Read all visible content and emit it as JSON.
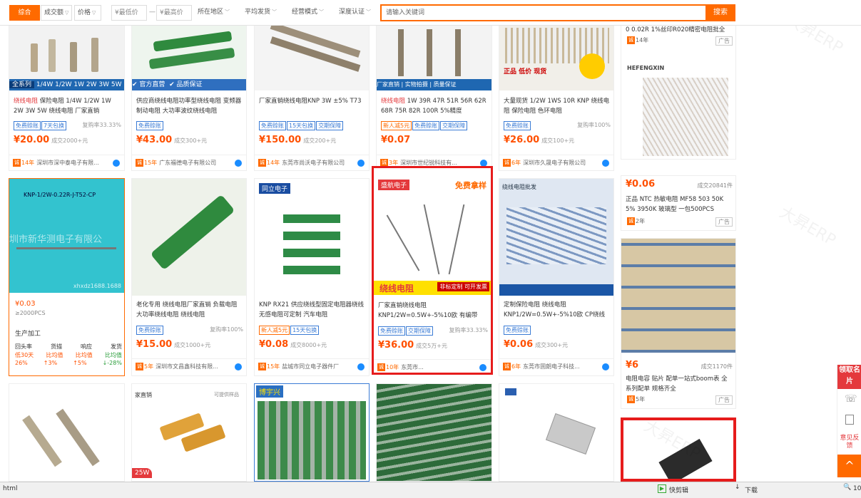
{
  "filters": {
    "comprehensive": "综合",
    "sales": "成交额",
    "price": "价格",
    "min_price": "¥最低价",
    "dash": "—",
    "max_price": "¥最高价",
    "location": "所在地区",
    "avg_ship": "平均发货",
    "business_mode": "经营模式",
    "deep_cert": "深度认证"
  },
  "search": {
    "placeholder": "请输入关键词",
    "button": "搜索"
  },
  "watermark": "大昇ERP",
  "row1": [
    {
      "banner_a": "全系列",
      "banner_b": "1/4W 1/2W 1W 2W 3W 5W",
      "title_red": "绕线电阻",
      "title_rest": " 保险电阻 1/4W 1/2W 1W 2W 3W 5W 绕线电阻 厂家直销",
      "tags": [
        "免费赊账",
        "7天包换"
      ],
      "repurchase": "复购率33.33%",
      "price": "¥20.00",
      "deals": "成交2000+元",
      "years": "14年",
      "shop": "深圳市深中泰电子有限..."
    },
    {
      "banner_a": "官方直营",
      "banner_b": "品质保证",
      "title_red": "",
      "title_rest": "供应商绕线电阻功率型绕线电阻 变频器制动电阻 大功率波纹绕线电阻",
      "tags": [
        "免费赊账"
      ],
      "repurchase": "",
      "price": "¥43.00",
      "deals": "成交300+元",
      "years": "15年",
      "shop": "广东福德电子有限公司"
    },
    {
      "title_red": "",
      "title_rest": "厂家直销绕线电阻KNP 3W ±5% T73",
      "tags": [
        "免费赊账",
        "15天包换",
        "交期保障"
      ],
      "repurchase": "",
      "price": "¥150.00",
      "deals": "成交200+元",
      "years": "14年",
      "shop": "东莞市尚沃电子有限公司"
    },
    {
      "banners": [
        "厂家直销",
        "实物拍摄",
        "质量保证"
      ],
      "title_red": "绕线电阻",
      "title_rest": " 1W 39R 47R 51R 56R 62R 68R 75R 82R 100R 5%精度",
      "tags": [
        "新人减5元",
        "免费赊账",
        "交期保障"
      ],
      "repurchase": "",
      "price": "¥0.07",
      "deals": "",
      "years": "3年",
      "shop": "深圳市世纪锐科技有..."
    },
    {
      "overlay": "正品 低价 现货",
      "title_red": "",
      "title_rest": "大量现货 1/2W 1WS 10R KNP 绕线电阻 保险电阻 色环电阻",
      "tags": [
        "免费赊账"
      ],
      "repurchase": "复购率100%",
      "price": "¥26.00",
      "deals": "成交100+元",
      "years": "6年",
      "shop": "深圳市久晟电子有限公司"
    }
  ],
  "row2": [
    {
      "img_label": "KNP-1/2W-0.22R-J-T52-CP",
      "img_company": "圳市新华测电子有限公",
      "img_site": "xhxdz1688.1688",
      "price": "¥0.03",
      "moq": "≥2000PCS",
      "section": "生产加工",
      "stats": [
        {
          "k": "回头率",
          "v": "26%",
          "c": "低30天"
        },
        {
          "k": "货描",
          "v": "↑3%",
          "c": "比均值"
        },
        {
          "k": "响应",
          "v": "↑5%",
          "c": "比均值"
        },
        {
          "k": "发货",
          "v": "↓-28%",
          "c": "比均值"
        }
      ]
    },
    {
      "title_red": "",
      "title_rest": "老化专用 绕线电阻厂家直销 负载电阻 大功率绕线电阻 绕线电阻",
      "tags": [
        "免费赊账"
      ],
      "repurchase": "复购率100%",
      "price": "¥15.00",
      "deals": "成交1000+元",
      "years": "5年",
      "shop": "深圳市文昌鑫科技有限..."
    },
    {
      "brand": "同立电子",
      "title_rest": "KNP RX21 供应绕线型固定电阻器绕线无感电阻可定制 汽车电阻",
      "tags": [
        "新人减5元",
        "15天包换"
      ],
      "repurchase": "",
      "price": "¥0.08",
      "deals": "成交8000+元",
      "years": "15年",
      "shop": "盐城市同立电子器件厂"
    },
    {
      "brand": "盛航电子",
      "badge": "免费拿样",
      "img_title": "绕线电阻",
      "img_tag": "非标定制 可开发票",
      "title_rest": "厂家直销绕线电阻 KNP1/2W=0.5W+-5%10欧 有编带",
      "tags": [
        "免费赊账",
        "交期保障"
      ],
      "repurchase": "复购率33.33%",
      "price": "¥36.00",
      "deals": "成交5万+元",
      "years": "10年",
      "shop": "东莞市..."
    },
    {
      "header": "绕线电阻批发",
      "title_rest": "定制保险电阻 绕线电阻 KNP1/2W=0.5W+-5%10欧 CP绕线",
      "tags": [
        "免费赊账"
      ],
      "repurchase": "",
      "price": "¥0.06",
      "deals": "成交300+元",
      "years": "6年",
      "shop": "东莞市固朗电子科技..."
    }
  ],
  "right": {
    "top_title": "0 0.02R 1%丝印R020精密电阻批全",
    "top_years": "14年",
    "ad": "广告",
    "brand": "HEFENGXIN",
    "p1_price": "¥0.06",
    "p1_deals": "成交20841件",
    "p1_title": "正品 NTC 热敏电阻 MF58 503 50K 5% 3950K 玻璃型 一包500PCS",
    "p1_years": "2年",
    "p2_price": "¥6",
    "p2_deals": "成交1170件",
    "p2_title": "电阻电容 贴片 配单一站式boom表 全系列配单 规格齐全",
    "p2_years": "5年"
  },
  "row3": [
    {
      "label": ""
    },
    {
      "header": "家直销",
      "sub": "可提供样品",
      "tag": "25W"
    },
    {
      "brand": "博宇兴"
    },
    {
      "label": ""
    },
    {
      "label": ""
    }
  ],
  "sidebar": {
    "card": "领取名片",
    "help": "意见反馈",
    "top": "^"
  },
  "statusbar": {
    "left": "html",
    "items": [
      "快剪辑",
      "下载"
    ],
    "zoom": "10"
  }
}
